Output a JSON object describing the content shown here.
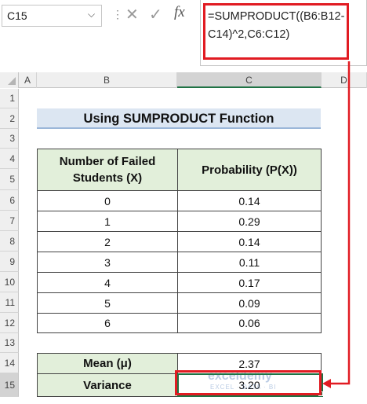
{
  "formula_bar": {
    "name_box": "C15",
    "fx_label": "fx",
    "formula": "=SUMPRODUCT((B6:B12-C14)^2,C6:C12)"
  },
  "columns": [
    "A",
    "B",
    "C",
    "D"
  ],
  "rows": [
    "1",
    "2",
    "3",
    "4",
    "5",
    "6",
    "7",
    "8",
    "9",
    "10",
    "11",
    "12",
    "13",
    "14",
    "15"
  ],
  "sheet": {
    "title": "Using SUMPRODUCT Function",
    "header_x": "Number of Failed Students (X)",
    "header_p": "Probability (P(X))",
    "table": [
      {
        "x": "0",
        "p": "0.14"
      },
      {
        "x": "1",
        "p": "0.29"
      },
      {
        "x": "2",
        "p": "0.14"
      },
      {
        "x": "3",
        "p": "0.11"
      },
      {
        "x": "4",
        "p": "0.17"
      },
      {
        "x": "5",
        "p": "0.09"
      },
      {
        "x": "6",
        "p": "0.06"
      }
    ],
    "mean_label": "Mean (μ)",
    "mean_value": "2.37",
    "variance_label": "Variance",
    "variance_value": "3.20"
  },
  "watermark": {
    "name": "exceldemy",
    "sub": "EXCEL · DATA · BI"
  },
  "colors": {
    "header_green": "#e2efda",
    "title_blue": "#dce6f2",
    "highlight_red": "#e11b22",
    "selection_green": "#1f7244"
  }
}
